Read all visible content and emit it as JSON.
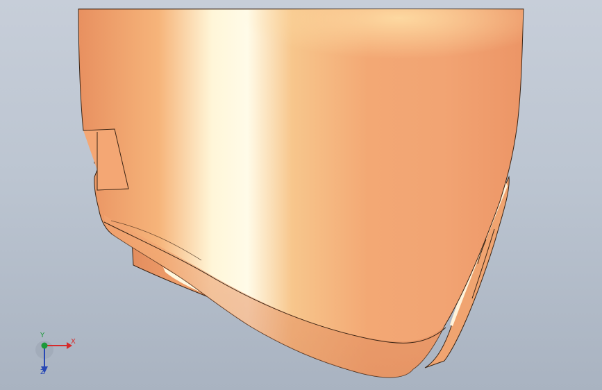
{
  "viewport": {
    "background_top": "#c7ced9",
    "background_bottom": "#a9b3c1"
  },
  "model": {
    "part": "shell-surface",
    "base_color": "#f2a36f",
    "highlight_color": "#fffbe6",
    "edge_color": "#3a2414"
  },
  "triad": {
    "x_label": "X",
    "y_label": "Y",
    "z_label": "Z",
    "x_color": "#d62a2a",
    "y_color": "#1c9a3a",
    "z_color": "#2747b5"
  }
}
